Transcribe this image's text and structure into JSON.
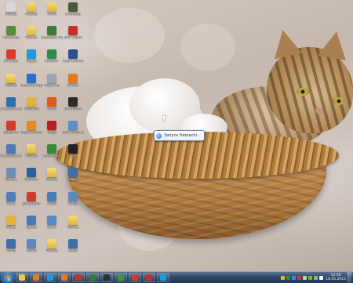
{
  "desktop": {
    "icons": [
      {
        "label": "Лорор",
        "color": "#d8d8d8"
      },
      {
        "label": "Файлы",
        "color": "#f2c84b",
        "folder": true
      },
      {
        "label": "Фото",
        "color": "#f2c84b",
        "folder": true
      },
      {
        "label": "Сталкер",
        "color": "#4b5a3a"
      },
      {
        "label": "Minecraft",
        "color": "#5b8c3a"
      },
      {
        "label": "Папка",
        "color": "#f2c84b",
        "folder": true
      },
      {
        "label": "Camtasia Studio",
        "color": "#3f7a3a"
      },
      {
        "label": "AVS Video",
        "color": "#c8302c"
      },
      {
        "label": "SHAREit",
        "color": "#d93a2c"
      },
      {
        "label": "Skype",
        "color": "#1e9be0"
      },
      {
        "label": "Клиент",
        "color": "#2f8a4a"
      },
      {
        "label": "Total Comm",
        "color": "#2e4f8a"
      },
      {
        "label": "Папка",
        "color": "#f2c84b",
        "folder": true
      },
      {
        "label": "Internet Explorer",
        "color": "#2a6fd0"
      },
      {
        "label": "Корзина",
        "color": "#9aa7b6"
      },
      {
        "label": "Firefox",
        "color": "#e37a1d"
      },
      {
        "label": "Обновление",
        "color": "#2f6fb2"
      },
      {
        "label": "Hamachi",
        "color": "#e2b23a"
      },
      {
        "label": "Avast",
        "color": "#e05a1a"
      },
      {
        "label": "Bandicam",
        "color": "#2c2c2c"
      },
      {
        "label": "Ccleaner",
        "color": "#d23a2a"
      },
      {
        "label": "Одноклассники",
        "color": "#e98c1f"
      },
      {
        "label": "Maps",
        "color": "#b81f1f"
      },
      {
        "label": "Мой компьютер",
        "color": "#5d8fc8"
      },
      {
        "label": "Программы",
        "color": "#4f79b0"
      },
      {
        "label": "Папка",
        "color": "#f2c84b",
        "folder": true
      },
      {
        "label": "Kaspersky",
        "color": "#3a8a3a"
      },
      {
        "label": "GTA",
        "color": "#222222"
      },
      {
        "label": "Ярлык",
        "color": "#6b8fb8"
      },
      {
        "label": "Панель",
        "color": "#2a5fa0"
      },
      {
        "label": "Папка",
        "color": "#f2c84b",
        "folder": true
      },
      {
        "label": "Видео",
        "color": "#3f6fa8"
      },
      {
        "label": "Сеть",
        "color": "#4d7fb6"
      },
      {
        "label": "Документ",
        "color": "#d23a2a"
      },
      {
        "label": "Word",
        "color": "#4d7fb6"
      },
      {
        "label": "Setup",
        "color": "#5d88c0"
      },
      {
        "label": "Игры",
        "color": "#e2b23a"
      },
      {
        "label": "Opera",
        "color": "#4a78b8"
      },
      {
        "label": "Сеть",
        "color": "#5a8ac4"
      },
      {
        "label": "Папка",
        "color": "#f2c84b",
        "folder": true
      },
      {
        "label": "Фото",
        "color": "#3f6fa8"
      },
      {
        "label": "Файл",
        "color": "#5d88c0"
      },
      {
        "label": "Папка",
        "color": "#f2c84b",
        "folder": true
      },
      {
        "label": "Music",
        "color": "#3f6fa8"
      }
    ]
  },
  "balloon": {
    "text": "Запуск Hamachi..."
  },
  "taskbar": {
    "apps": [
      {
        "name": "explorer-folder",
        "color": "#f2c84b"
      },
      {
        "name": "media-player",
        "color": "#e37a1d"
      },
      {
        "name": "skype",
        "color": "#1e9be0"
      },
      {
        "name": "firefox",
        "color": "#e37a1d"
      },
      {
        "name": "opera",
        "color": "#c8302c"
      },
      {
        "name": "camtasia",
        "color": "#3f7a3a"
      },
      {
        "name": "bandicam",
        "color": "#2c2c2c"
      },
      {
        "name": "chrome",
        "color": "#3a9a3a"
      },
      {
        "name": "ccleaner",
        "color": "#d23a2a"
      },
      {
        "name": "recorder",
        "color": "#c8302c"
      },
      {
        "name": "skype-active",
        "color": "#1e9be0"
      }
    ],
    "tray_colors": [
      "#e2b23a",
      "#3a8a3a",
      "#1e9be0",
      "#d23a2a",
      "#c8c8c8",
      "#7fba00",
      "#9aa7b6",
      "#ffffff"
    ],
    "clock": {
      "time": "12:56",
      "date": "18.05.2015"
    }
  }
}
